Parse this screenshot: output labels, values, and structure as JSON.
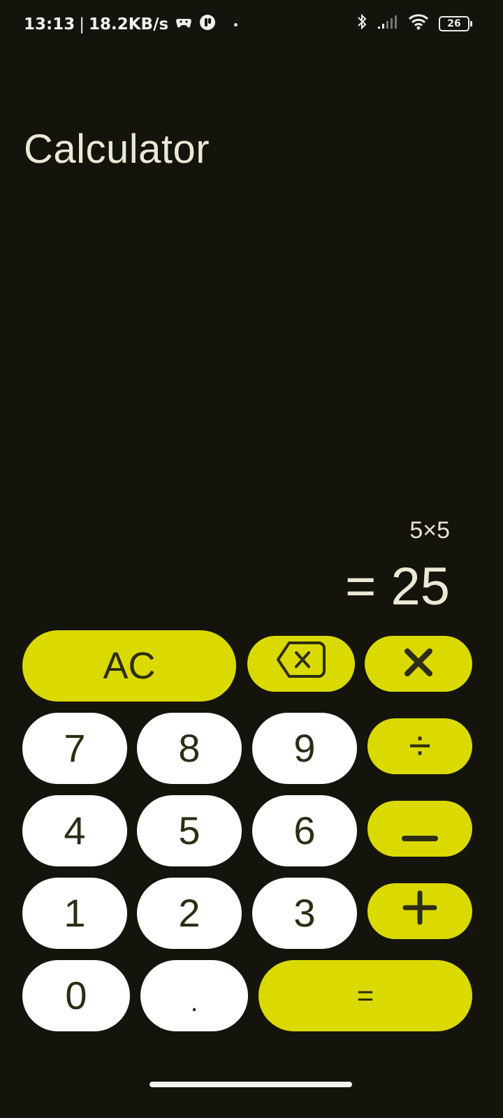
{
  "status_bar": {
    "time": "13:13",
    "separator": "|",
    "speed": "18.2KB/s",
    "battery": "26",
    "icons": [
      "game-controller-icon",
      "app-icon",
      "dot-icon",
      "bluetooth-icon",
      "signal-icon",
      "wifi-icon",
      "battery-icon"
    ]
  },
  "app": {
    "title": "Calculator"
  },
  "display": {
    "expression": "5×5",
    "result": "= 25"
  },
  "keypad": {
    "clear": "AC",
    "backspace_icon": "backspace-icon",
    "multiply_icon": "multiply-icon",
    "seven": "7",
    "eight": "8",
    "nine": "9",
    "divide": "÷",
    "four": "4",
    "five": "5",
    "six": "6",
    "minus_icon": "minus-icon",
    "one": "1",
    "two": "2",
    "three": "3",
    "plus_icon": "plus-icon",
    "zero": "0",
    "decimal": ".",
    "equals": "="
  },
  "colors": {
    "background": "#14140c",
    "accent": "#dada00",
    "number_key": "#ffffff",
    "key_text": "#2d2c14",
    "display_text": "#ece8d6"
  }
}
